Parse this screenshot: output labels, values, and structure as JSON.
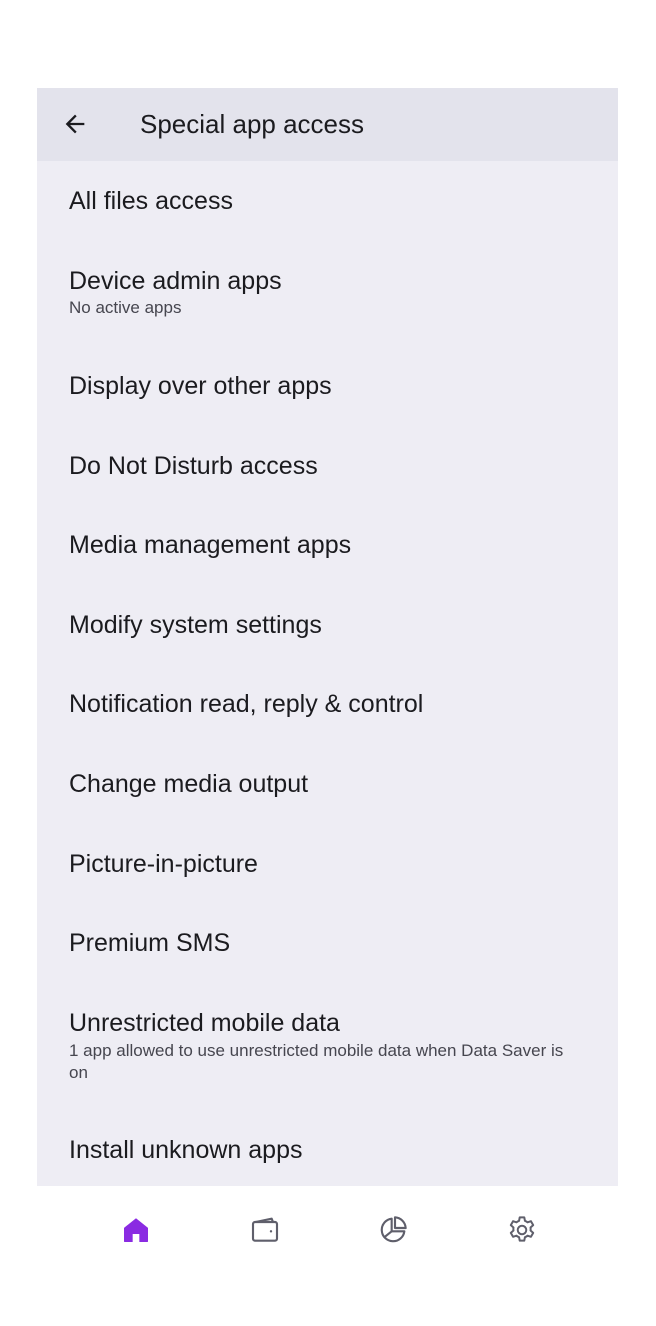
{
  "appbar": {
    "title": "Special app access",
    "back_icon": "arrow-left-icon"
  },
  "items": [
    {
      "title": "All files access",
      "subtitle": ""
    },
    {
      "title": "Device admin apps",
      "subtitle": "No active apps"
    },
    {
      "title": "Display over other apps",
      "subtitle": ""
    },
    {
      "title": "Do Not Disturb access",
      "subtitle": ""
    },
    {
      "title": "Media management apps",
      "subtitle": ""
    },
    {
      "title": "Modify system settings",
      "subtitle": ""
    },
    {
      "title": "Notification read, reply & control",
      "subtitle": ""
    },
    {
      "title": "Change media output",
      "subtitle": ""
    },
    {
      "title": "Picture-in-picture",
      "subtitle": ""
    },
    {
      "title": "Premium SMS",
      "subtitle": ""
    },
    {
      "title": "Unrestricted mobile data",
      "subtitle": "1 app allowed to use unrestricted mobile data when Data Saver is on"
    },
    {
      "title": "Install unknown apps",
      "subtitle": ""
    }
  ],
  "bottom_nav": {
    "items": [
      {
        "icon": "home-icon",
        "active": true
      },
      {
        "icon": "wallet-icon",
        "active": false
      },
      {
        "icon": "pie-chart-icon",
        "active": false
      },
      {
        "icon": "gear-icon",
        "active": false
      }
    ]
  },
  "colors": {
    "accent": "#8a2be2",
    "icon_inactive": "#5f5f6b",
    "panel_bg": "#eeedf4",
    "appbar_bg": "#e3e3ec",
    "text_primary": "#1b1b1f",
    "text_secondary": "#46464f"
  }
}
